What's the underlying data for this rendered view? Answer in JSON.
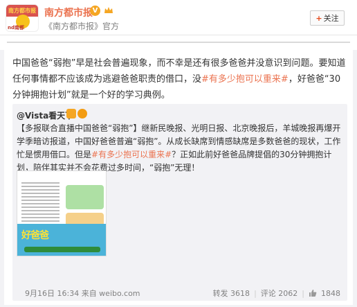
{
  "header": {
    "account_name": "南方都市报",
    "account_desc": "《南方都市报》官方",
    "follow_label": "关注",
    "follow_plus": "+",
    "logo_band": "南方都市报",
    "logo_sub": "nd南都"
  },
  "post": {
    "text_1": "中国爸爸“弱抱”早是社会普遍现象，而不幸是还有很多爸爸并没意识到问题。要知道任何事情都不应该成为逃避爸爸职责的借口，没",
    "hashtag": "#有多少抱可以重来#",
    "text_2": "，好爸爸“30分钟拥抱计划”就是一个好的学习典例。"
  },
  "repost": {
    "author": "@Vista看天下",
    "text_1": "【多报联合直播中国爸爸“弱抱”】继新民晚报、光明日报、北京晚报后，羊城晚报再爆开学季暗访报道，中国好爸爸普遍“弱抱”。从成长缺席到情感缺席是多数爸爸的现状，工作忙是惯用借口。但是",
    "hashtag": "#有多少抱可以重来#",
    "text_2": "？正如此前好爸爸品牌提倡的30分钟拥抱计划，陪伴其实并不会花费过多时间，“弱抱”无理！",
    "thumb_words": "好爸爸",
    "timestamp": "9月16日 16:34 来自 weibo.com",
    "repost_label": "转发 3618",
    "comment_label": "评论 2062",
    "like_count": "1848"
  },
  "colors": {
    "accent": "#eb7350",
    "verified": "#f5a623"
  }
}
